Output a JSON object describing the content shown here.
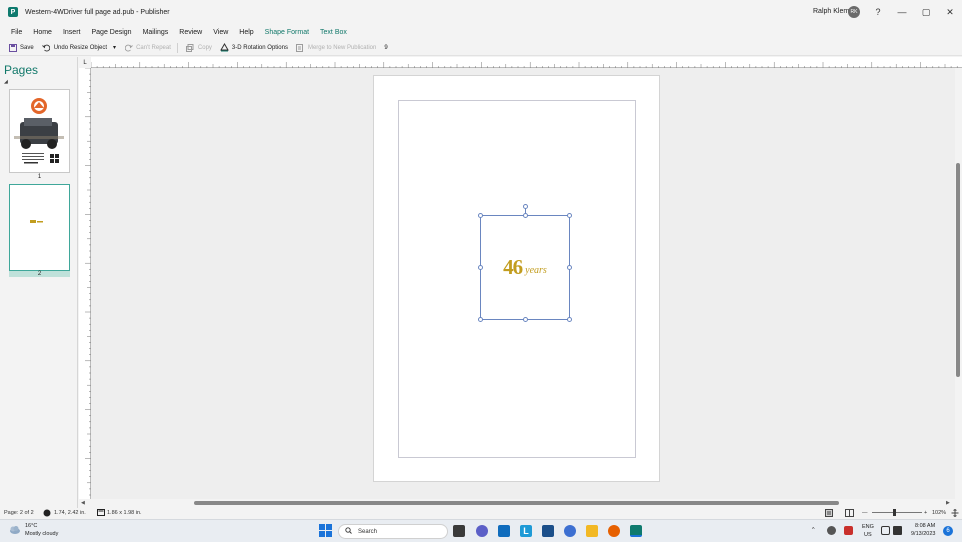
{
  "titlebar": {
    "app_letter": "P",
    "title": "Western-4WDriver full page ad.pub  -  Publisher",
    "user_name": "Ralph Klem",
    "user_initials": "RK",
    "help": "?",
    "minimize": "—",
    "restore": "▢",
    "close": "✕"
  },
  "menu": {
    "items": [
      "File",
      "Home",
      "Insert",
      "Page Design",
      "Mailings",
      "Review",
      "View",
      "Help"
    ],
    "contextual": [
      "Shape Format",
      "Text Box"
    ]
  },
  "toolbar": {
    "save": "Save",
    "undo": "Undo Resize Object",
    "undo_dropdown": "▾",
    "cant_repeat": "Can't Repeat",
    "copy": "Copy",
    "rotation": "3-D Rotation Options",
    "merge": "Merge to New Publication",
    "overflow": "9"
  },
  "pages_pane": {
    "title": "Pages",
    "collapse": "◢",
    "thumbs": [
      {
        "number": "1"
      },
      {
        "number": "2"
      }
    ]
  },
  "ruler": {
    "corner": "L"
  },
  "document": {
    "number": "46",
    "word": "years"
  },
  "status": {
    "page": "Page: 2 of 2",
    "position": "1.74, 2.42 in.",
    "size": "1.86 x 1.98 in.",
    "zoom": "102%",
    "zoom_minus": "—",
    "zoom_plus": "+"
  },
  "taskbar": {
    "temp": "16°C",
    "condition": "Mostly cloudy",
    "search": "Search",
    "lang_top": "ENG",
    "lang_bottom": "US",
    "time": "8:08 AM",
    "date": "9/13/2023",
    "notif": "6"
  },
  "colors": {
    "accent": "#11786a",
    "gold": "#c29d1f",
    "selection": "#6a86c0"
  }
}
